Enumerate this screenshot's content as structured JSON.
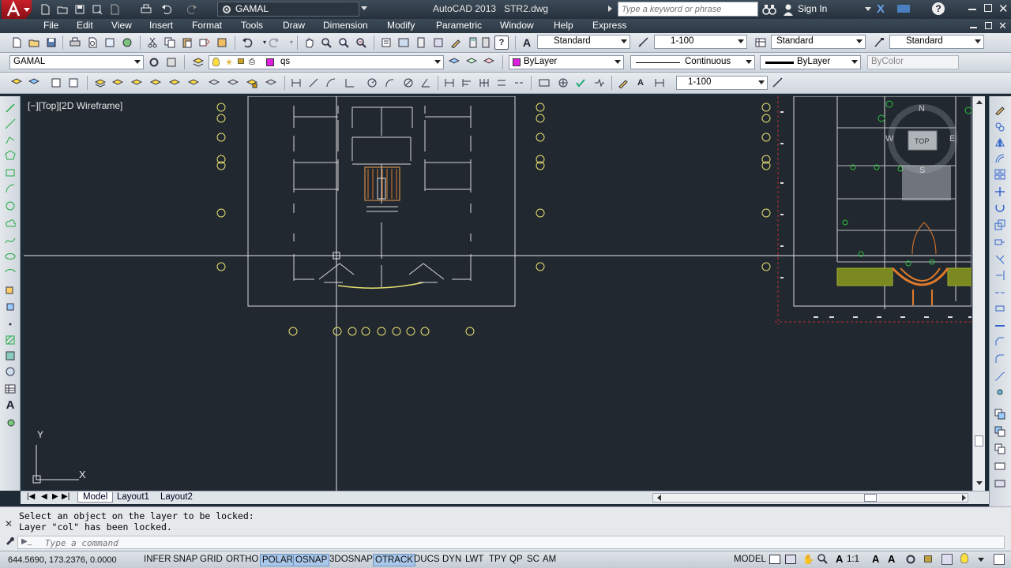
{
  "titlebar": {
    "workspace": "GAMAL",
    "app_title": "AutoCAD 2013",
    "file_name": "STR2.dwg",
    "search_placeholder": "Type a keyword or phrase",
    "sign_in": "Sign In"
  },
  "menubar": {
    "items": [
      "File",
      "Edit",
      "View",
      "Insert",
      "Format",
      "Tools",
      "Draw",
      "Dimension",
      "Modify",
      "Parametric",
      "Window",
      "Help",
      "Express"
    ]
  },
  "styles_toolbar": {
    "text_style": "Standard",
    "dim_scale": "1-100",
    "dim_style": "Standard",
    "table_style": "Standard"
  },
  "layers_toolbar": {
    "workspace_combo": "GAMAL",
    "current_layer": "qs",
    "color": "ByLayer",
    "linetype": "Continuous",
    "lineweight": "ByLayer",
    "plot_style": "ByColor"
  },
  "dimension_toolbar": {
    "dim_scale": "1-100"
  },
  "viewport": {
    "label": "[−][Top][2D Wireframe]",
    "ucs_y": "Y",
    "ucs_x": "X",
    "viewcube_top": "TOP",
    "viewcube_n": "N",
    "viewcube_w": "W",
    "viewcube_e": "E",
    "viewcube_s": "S"
  },
  "layout_tabs": [
    "Model",
    "Layout1",
    "Layout2"
  ],
  "command": {
    "history": [
      "Select an object on the layer to be locked:",
      "Layer \"col\" has been locked."
    ],
    "placeholder": "Type a command"
  },
  "statusbar": {
    "coords": "644.5690, 173.2376, 0.0000",
    "toggles": [
      {
        "label": "INFER",
        "on": false
      },
      {
        "label": "SNAP",
        "on": false
      },
      {
        "label": "GRID",
        "on": false
      },
      {
        "label": "ORTHO",
        "on": false
      },
      {
        "label": "POLAR",
        "on": true
      },
      {
        "label": "OSNAP",
        "on": true
      },
      {
        "label": "3DOSNAP",
        "on": false
      },
      {
        "label": "OTRACK",
        "on": true
      },
      {
        "label": "DUCS",
        "on": false
      },
      {
        "label": "DYN",
        "on": false
      },
      {
        "label": "LWT",
        "on": false
      },
      {
        "label": "TPY",
        "on": false
      },
      {
        "label": "QP",
        "on": false
      },
      {
        "label": "SC",
        "on": false
      },
      {
        "label": "AM",
        "on": false
      }
    ],
    "space": "MODEL",
    "annotation_scale": "1:1"
  },
  "colors": {
    "canvas_bg": "#212830",
    "accent_red": "#d02020",
    "toggle_on": "#a9c7ea",
    "layer_color_swatch": "#e020e0"
  }
}
